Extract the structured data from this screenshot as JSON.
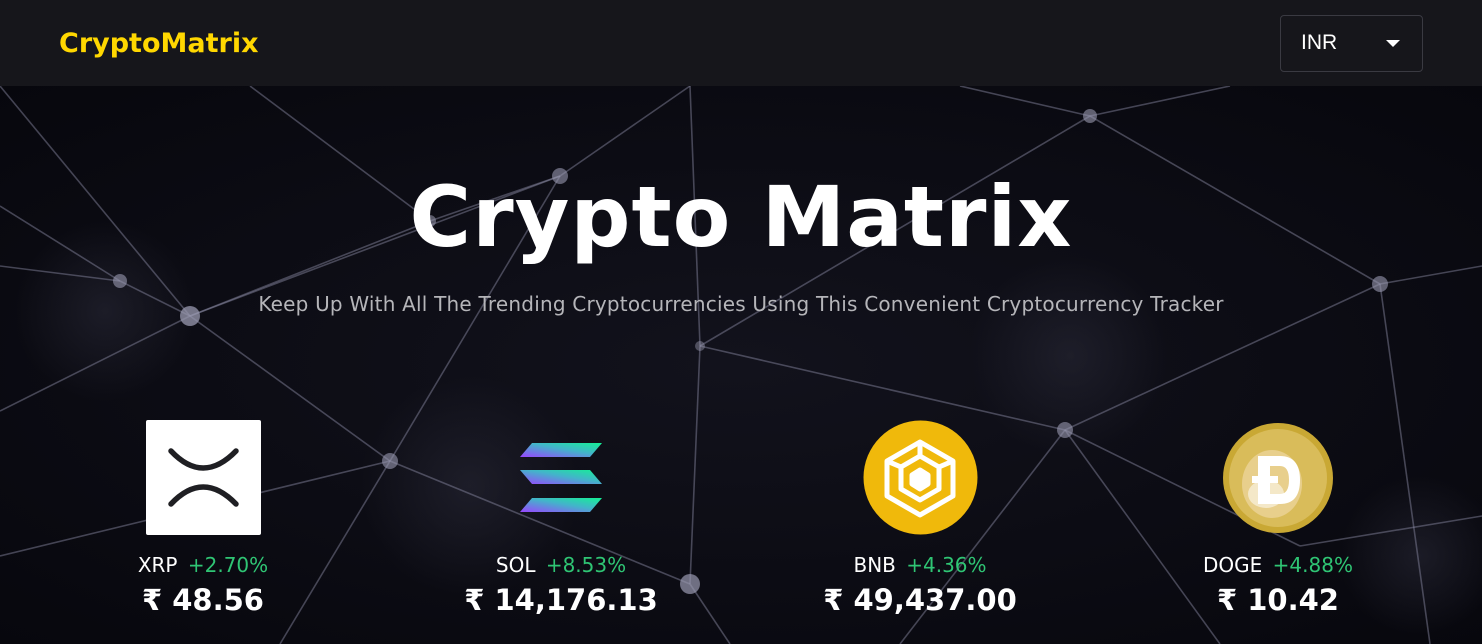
{
  "header": {
    "brand": "CryptoMatrix",
    "currency": {
      "selected": "INR"
    }
  },
  "hero": {
    "title": "Crypto Matrix",
    "subtitle": "Keep Up With All The Trending Cryptocurrencies Using This Convenient Cryptocurrency Tracker"
  },
  "carousel": [
    {
      "symbol": "XRP",
      "change": "+2.70%",
      "price": "₹ 48.56",
      "icon": "xrp-logo-icon"
    },
    {
      "symbol": "SOL",
      "change": "+8.53%",
      "price": "₹ 14,176.13",
      "icon": "solana-logo-icon"
    },
    {
      "symbol": "BNB",
      "change": "+4.36%",
      "price": "₹ 49,437.00",
      "icon": "bnb-logo-icon"
    },
    {
      "symbol": "DOGE",
      "change": "+4.88%",
      "price": "₹ 10.42",
      "icon": "doge-logo-icon"
    }
  ],
  "colors": {
    "brand": "#ffd700",
    "positive": "#2fc574",
    "background": "#0b0b12"
  }
}
